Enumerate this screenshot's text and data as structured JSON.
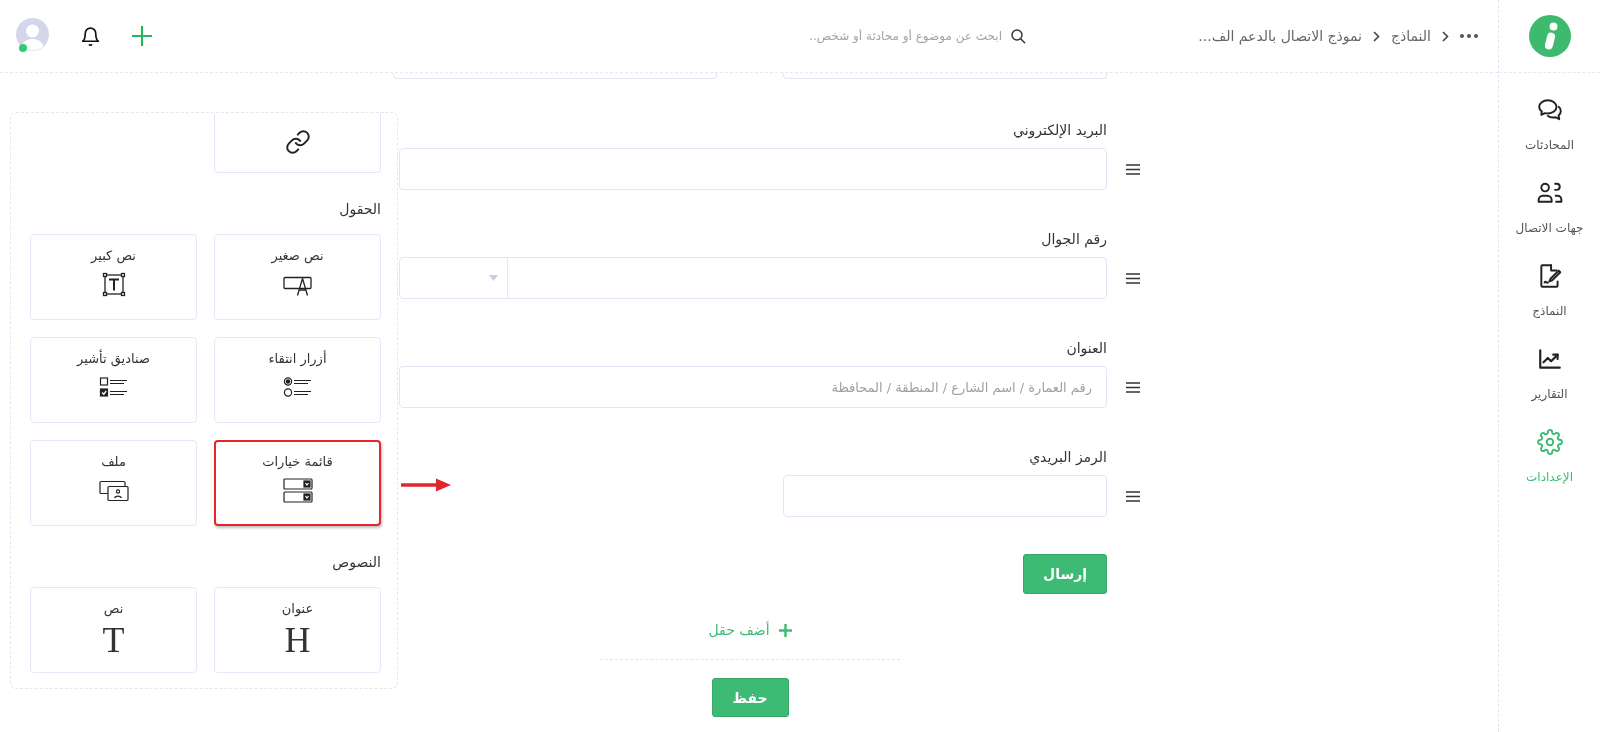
{
  "sidebar": {
    "items": [
      {
        "kind": "chats",
        "label": "المحادثات",
        "selected": false
      },
      {
        "kind": "contacts",
        "label": "جهات الاتصال",
        "selected": false
      },
      {
        "kind": "forms",
        "label": "النماذج",
        "selected": false
      },
      {
        "kind": "reports",
        "label": "التقارير",
        "selected": false
      },
      {
        "kind": "settings",
        "label": "الإعدادات",
        "selected": true
      }
    ]
  },
  "breadcrumb": [
    {
      "label": "النماذج"
    },
    {
      "label": "نموذج الاتصال بالدعم الف..."
    }
  ],
  "search": {
    "placeholder": "ابحث عن موضوع أو محادثة أو شخص.."
  },
  "user": {
    "online": true
  },
  "field_panel": {
    "sections": [
      {
        "cards": [
          {
            "kind": "link",
            "highlighted": false
          }
        ]
      },
      {
        "title": "الحقول",
        "cards": [
          {
            "kind": "short_text",
            "label": "نص صغير",
            "highlighted": false
          },
          {
            "kind": "long_text",
            "label": "نص كبير",
            "highlighted": false
          },
          {
            "kind": "radio",
            "label": "أزرار انتقاء",
            "highlighted": false
          },
          {
            "kind": "checkbox",
            "label": "صناديق تأشير",
            "highlighted": false
          },
          {
            "kind": "dropdown",
            "label": "قائمة خيارات",
            "highlighted": true
          },
          {
            "kind": "file",
            "label": "ملف",
            "highlighted": false
          }
        ]
      },
      {
        "title": "النصوص",
        "cards": [
          {
            "kind": "heading",
            "label": "عنوان",
            "glyph": "H",
            "highlighted": false
          },
          {
            "kind": "paragraph",
            "label": "نص",
            "glyph": "T",
            "highlighted": false
          }
        ]
      }
    ]
  },
  "form": {
    "fields": [
      {
        "kind": "cut_pair"
      },
      {
        "kind": "text",
        "label": "البريد الإلكتروني"
      },
      {
        "kind": "phone",
        "label": "رقم الجوال"
      },
      {
        "kind": "text",
        "label": "العنوان",
        "placeholder": "رقم العمارة / اسم الشارع / المنطقة / المحافظة"
      },
      {
        "kind": "short",
        "label": "الرمز البريدي"
      }
    ],
    "submit": "إرسال",
    "add_field": "أضف حقل",
    "save": "حفظ"
  }
}
